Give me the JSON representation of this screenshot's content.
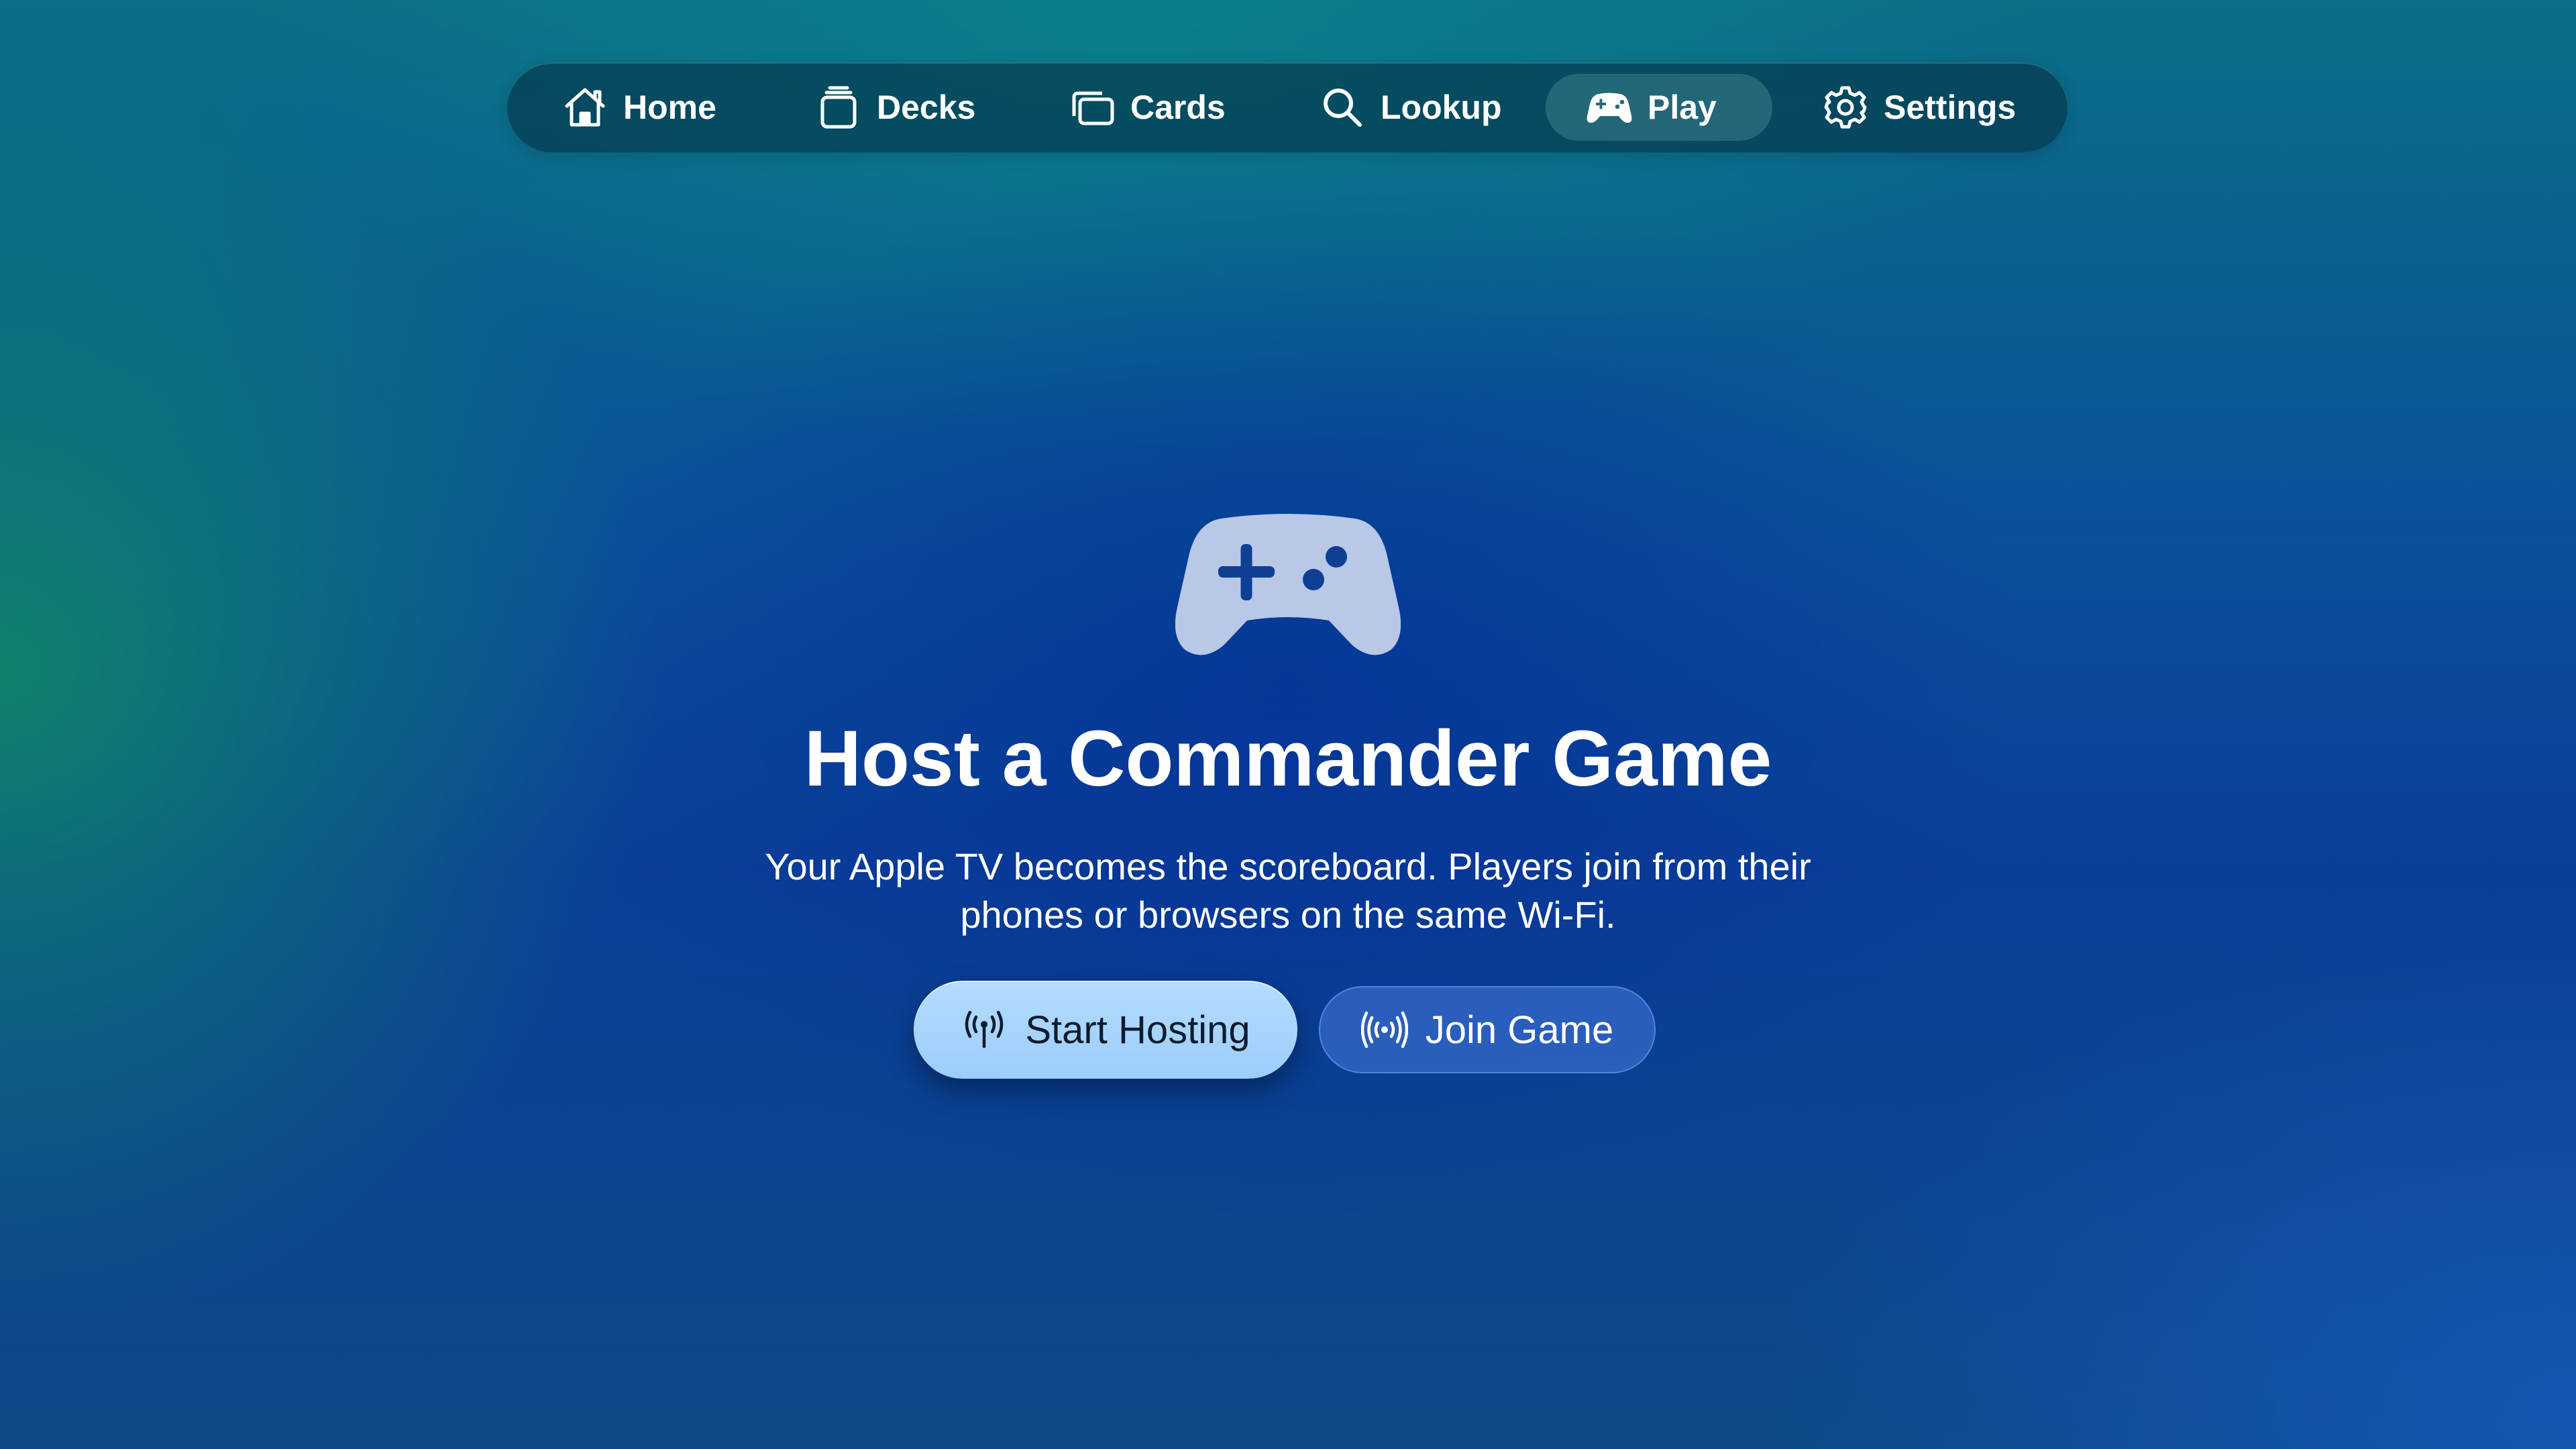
{
  "nav": {
    "items": [
      {
        "label": "Home",
        "icon": "house-icon",
        "active": false
      },
      {
        "label": "Decks",
        "icon": "stacked-cards-icon",
        "active": false
      },
      {
        "label": "Cards",
        "icon": "two-cards-icon",
        "active": false
      },
      {
        "label": "Lookup",
        "icon": "magnifying-glass-icon",
        "active": false
      },
      {
        "label": "Play",
        "icon": "game-controller-icon",
        "active": true
      },
      {
        "label": "Settings",
        "icon": "gear-icon",
        "active": false
      }
    ]
  },
  "hero": {
    "icon": "game-controller-icon",
    "title": "Host a Commander Game",
    "subtitle": "Your Apple TV becomes the scoreboard. Players join from their phones or browsers on the same Wi-Fi."
  },
  "actions": {
    "start_hosting": {
      "label": "Start Hosting",
      "icon": "antenna-broadcast-icon"
    },
    "join_game": {
      "label": "Join Game",
      "icon": "wireless-waves-icon"
    }
  },
  "colors": {
    "nav_background": "#04324a",
    "primary_button": "#a8d4fd",
    "secondary_button": "#4678dc",
    "hero_icon": "#b7c6e6"
  }
}
